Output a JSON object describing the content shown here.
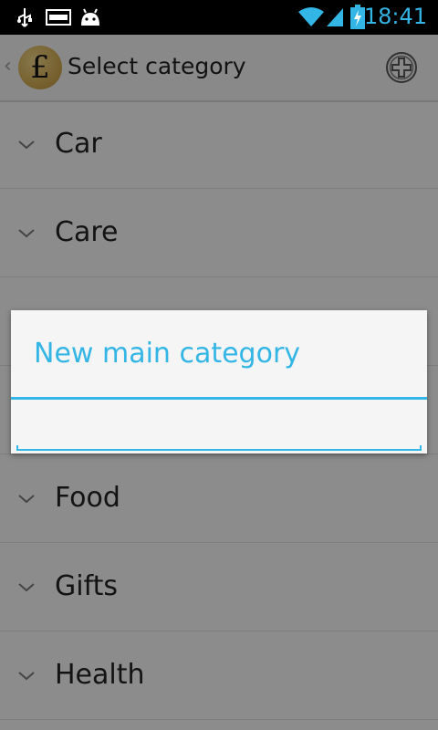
{
  "status_bar": {
    "time": "18:41",
    "icons": [
      "usb-icon",
      "wifi-icon",
      "signal-icon",
      "battery-charging-icon",
      "android-icon"
    ]
  },
  "action_bar": {
    "title": "Select category",
    "app_icon_glyph": "£"
  },
  "categories": [
    {
      "label": "Car"
    },
    {
      "label": "Care"
    },
    {
      "label": ""
    },
    {
      "label": ""
    },
    {
      "label": "Food"
    },
    {
      "label": "Gifts"
    },
    {
      "label": "Health"
    }
  ],
  "dialog": {
    "title": "New main category",
    "input_value": ""
  },
  "colors": {
    "accent": "#33b5e5"
  }
}
